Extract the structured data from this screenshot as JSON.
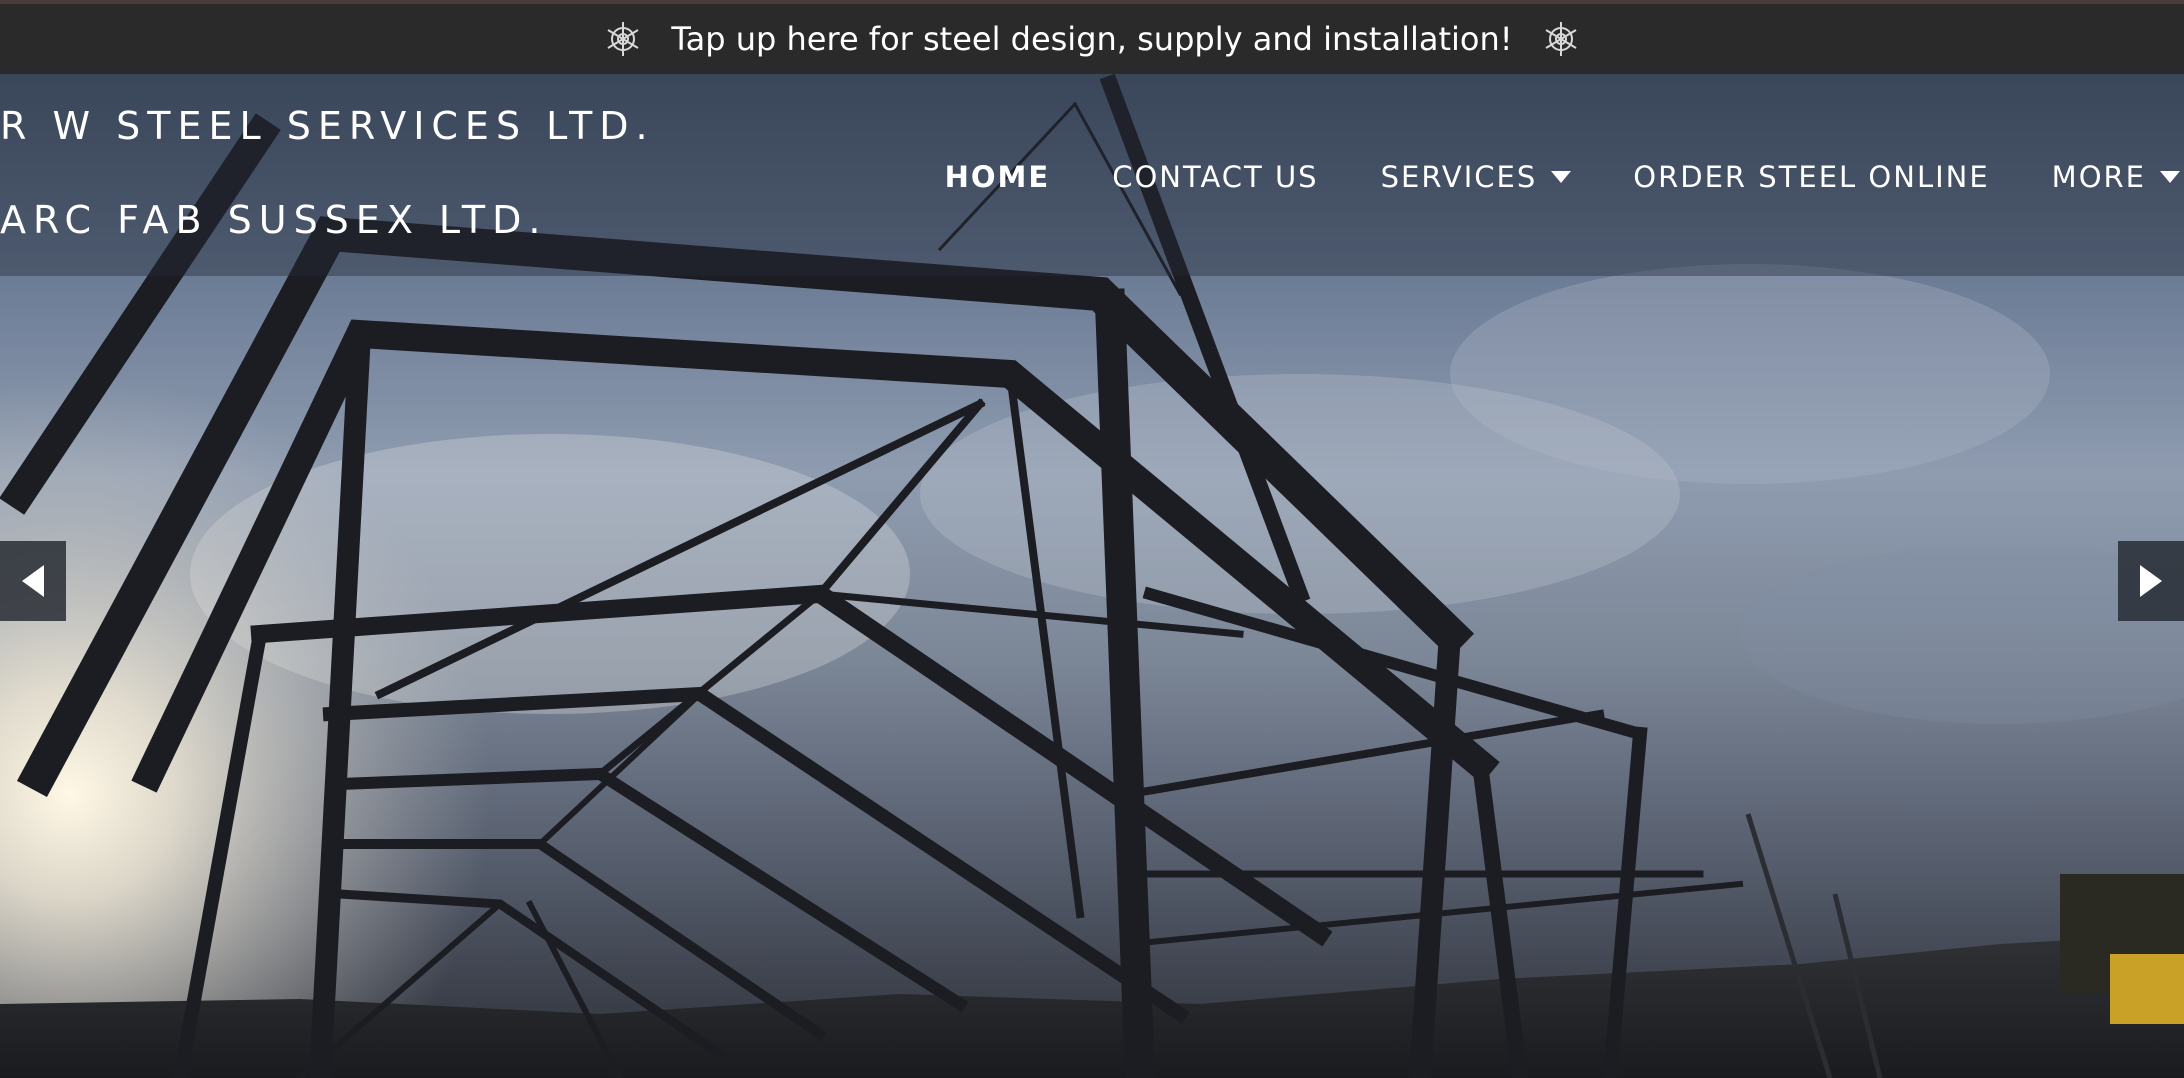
{
  "announcement": {
    "text": "Tap up here for steel design, supply and installation!",
    "left_icon": "snowflake-icon",
    "right_icon": "snowflake-icon"
  },
  "brand": {
    "line1": "R W STEEL SERVICES LTD.",
    "line2": "ARC FAB SUSSEX LTD."
  },
  "nav": {
    "home": "HOME",
    "contact": "CONTACT US",
    "services": "SERVICES",
    "order": "ORDER STEEL ONLINE",
    "more": "MORE"
  },
  "slider": {
    "prev_icon": "chevron-left-icon",
    "next_icon": "chevron-right-icon"
  },
  "colors": {
    "topbar_bg": "#2a2a2b",
    "text": "#ffffff",
    "arrow_bg": "#282d34"
  }
}
